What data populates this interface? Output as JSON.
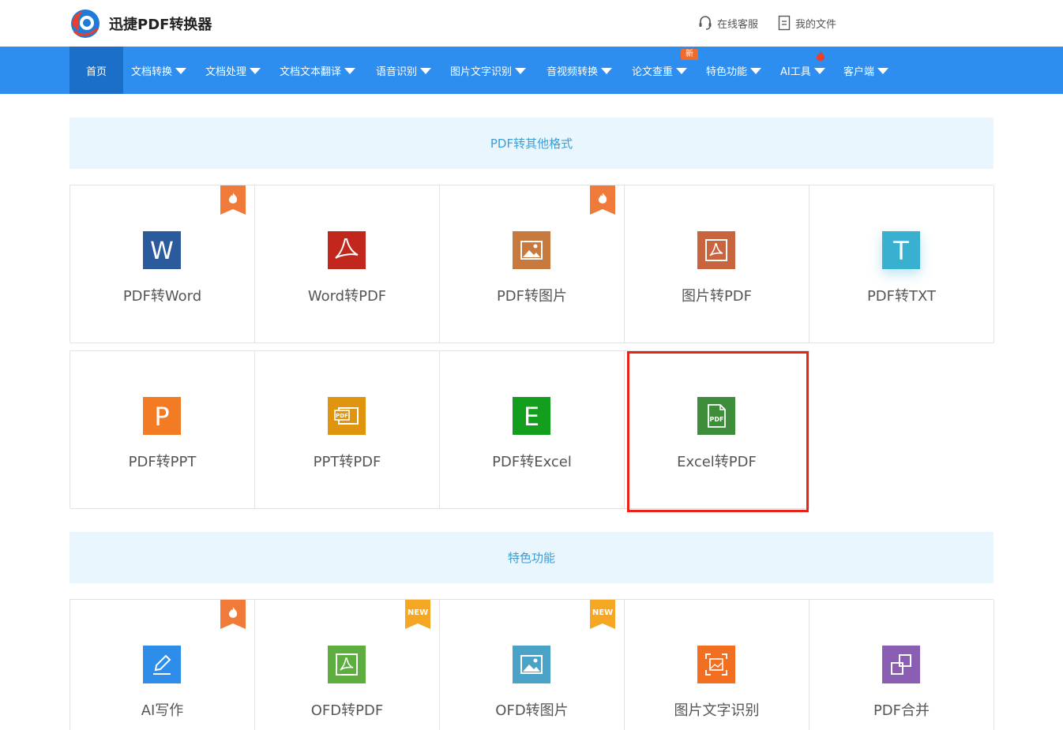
{
  "header": {
    "logo_text": "迅捷PDF转换器",
    "links": {
      "service": "在线客服",
      "files": "我的文件"
    }
  },
  "nav": {
    "items": [
      {
        "label": "首页",
        "active": true
      },
      {
        "label": "文档转换"
      },
      {
        "label": "文档处理"
      },
      {
        "label": "文档文本翻译"
      },
      {
        "label": "语音识别"
      },
      {
        "label": "图片文字识别"
      },
      {
        "label": "音视频转换"
      },
      {
        "label": "论文查重",
        "badge": "新"
      },
      {
        "label": "特色功能"
      },
      {
        "label": "AI工具",
        "badge_icon": "flame-icon"
      },
      {
        "label": "客户端"
      }
    ]
  },
  "sections": [
    {
      "title": "PDF转其他格式",
      "items": [
        {
          "label": "PDF转Word",
          "icon": "word-icon",
          "color": "#2b5b9d",
          "ribbon": "hot"
        },
        {
          "label": "Word转PDF",
          "icon": "pdf-acrobat-icon",
          "color": "#c1271d"
        },
        {
          "label": "PDF转图片",
          "icon": "image-icon",
          "color": "#c87a3e",
          "ribbon": "hot"
        },
        {
          "label": "图片转PDF",
          "icon": "image-to-pdf-icon",
          "color": "#c8643e"
        },
        {
          "label": "PDF转TXT",
          "icon": "text-icon",
          "color": "#3ab0d0"
        },
        {
          "label": "PDF转PPT",
          "icon": "ppt-icon",
          "color": "#f27b23"
        },
        {
          "label": "PPT转PDF",
          "icon": "ppt-to-pdf-icon",
          "color": "#e0950e"
        },
        {
          "label": "PDF转Excel",
          "icon": "excel-icon",
          "color": "#139e1d"
        },
        {
          "label": "Excel转PDF",
          "icon": "excel-to-pdf-icon",
          "color": "#3e8d3a"
        }
      ]
    },
    {
      "title": "特色功能",
      "items": [
        {
          "label": "AI写作",
          "icon": "pen-icon",
          "color": "#2e8de8",
          "ribbon": "hot"
        },
        {
          "label": "OFD转PDF",
          "icon": "ofd-to-pdf-icon",
          "color": "#5dae3e",
          "ribbon": "NEW"
        },
        {
          "label": "OFD转图片",
          "icon": "ofd-to-image-icon",
          "color": "#4aa3c6",
          "ribbon": "NEW"
        },
        {
          "label": "图片文字识别",
          "icon": "ocr-icon",
          "color": "#f26f22"
        },
        {
          "label": "PDF合并",
          "icon": "merge-icon",
          "color": "#8a5fb3"
        }
      ]
    }
  ]
}
